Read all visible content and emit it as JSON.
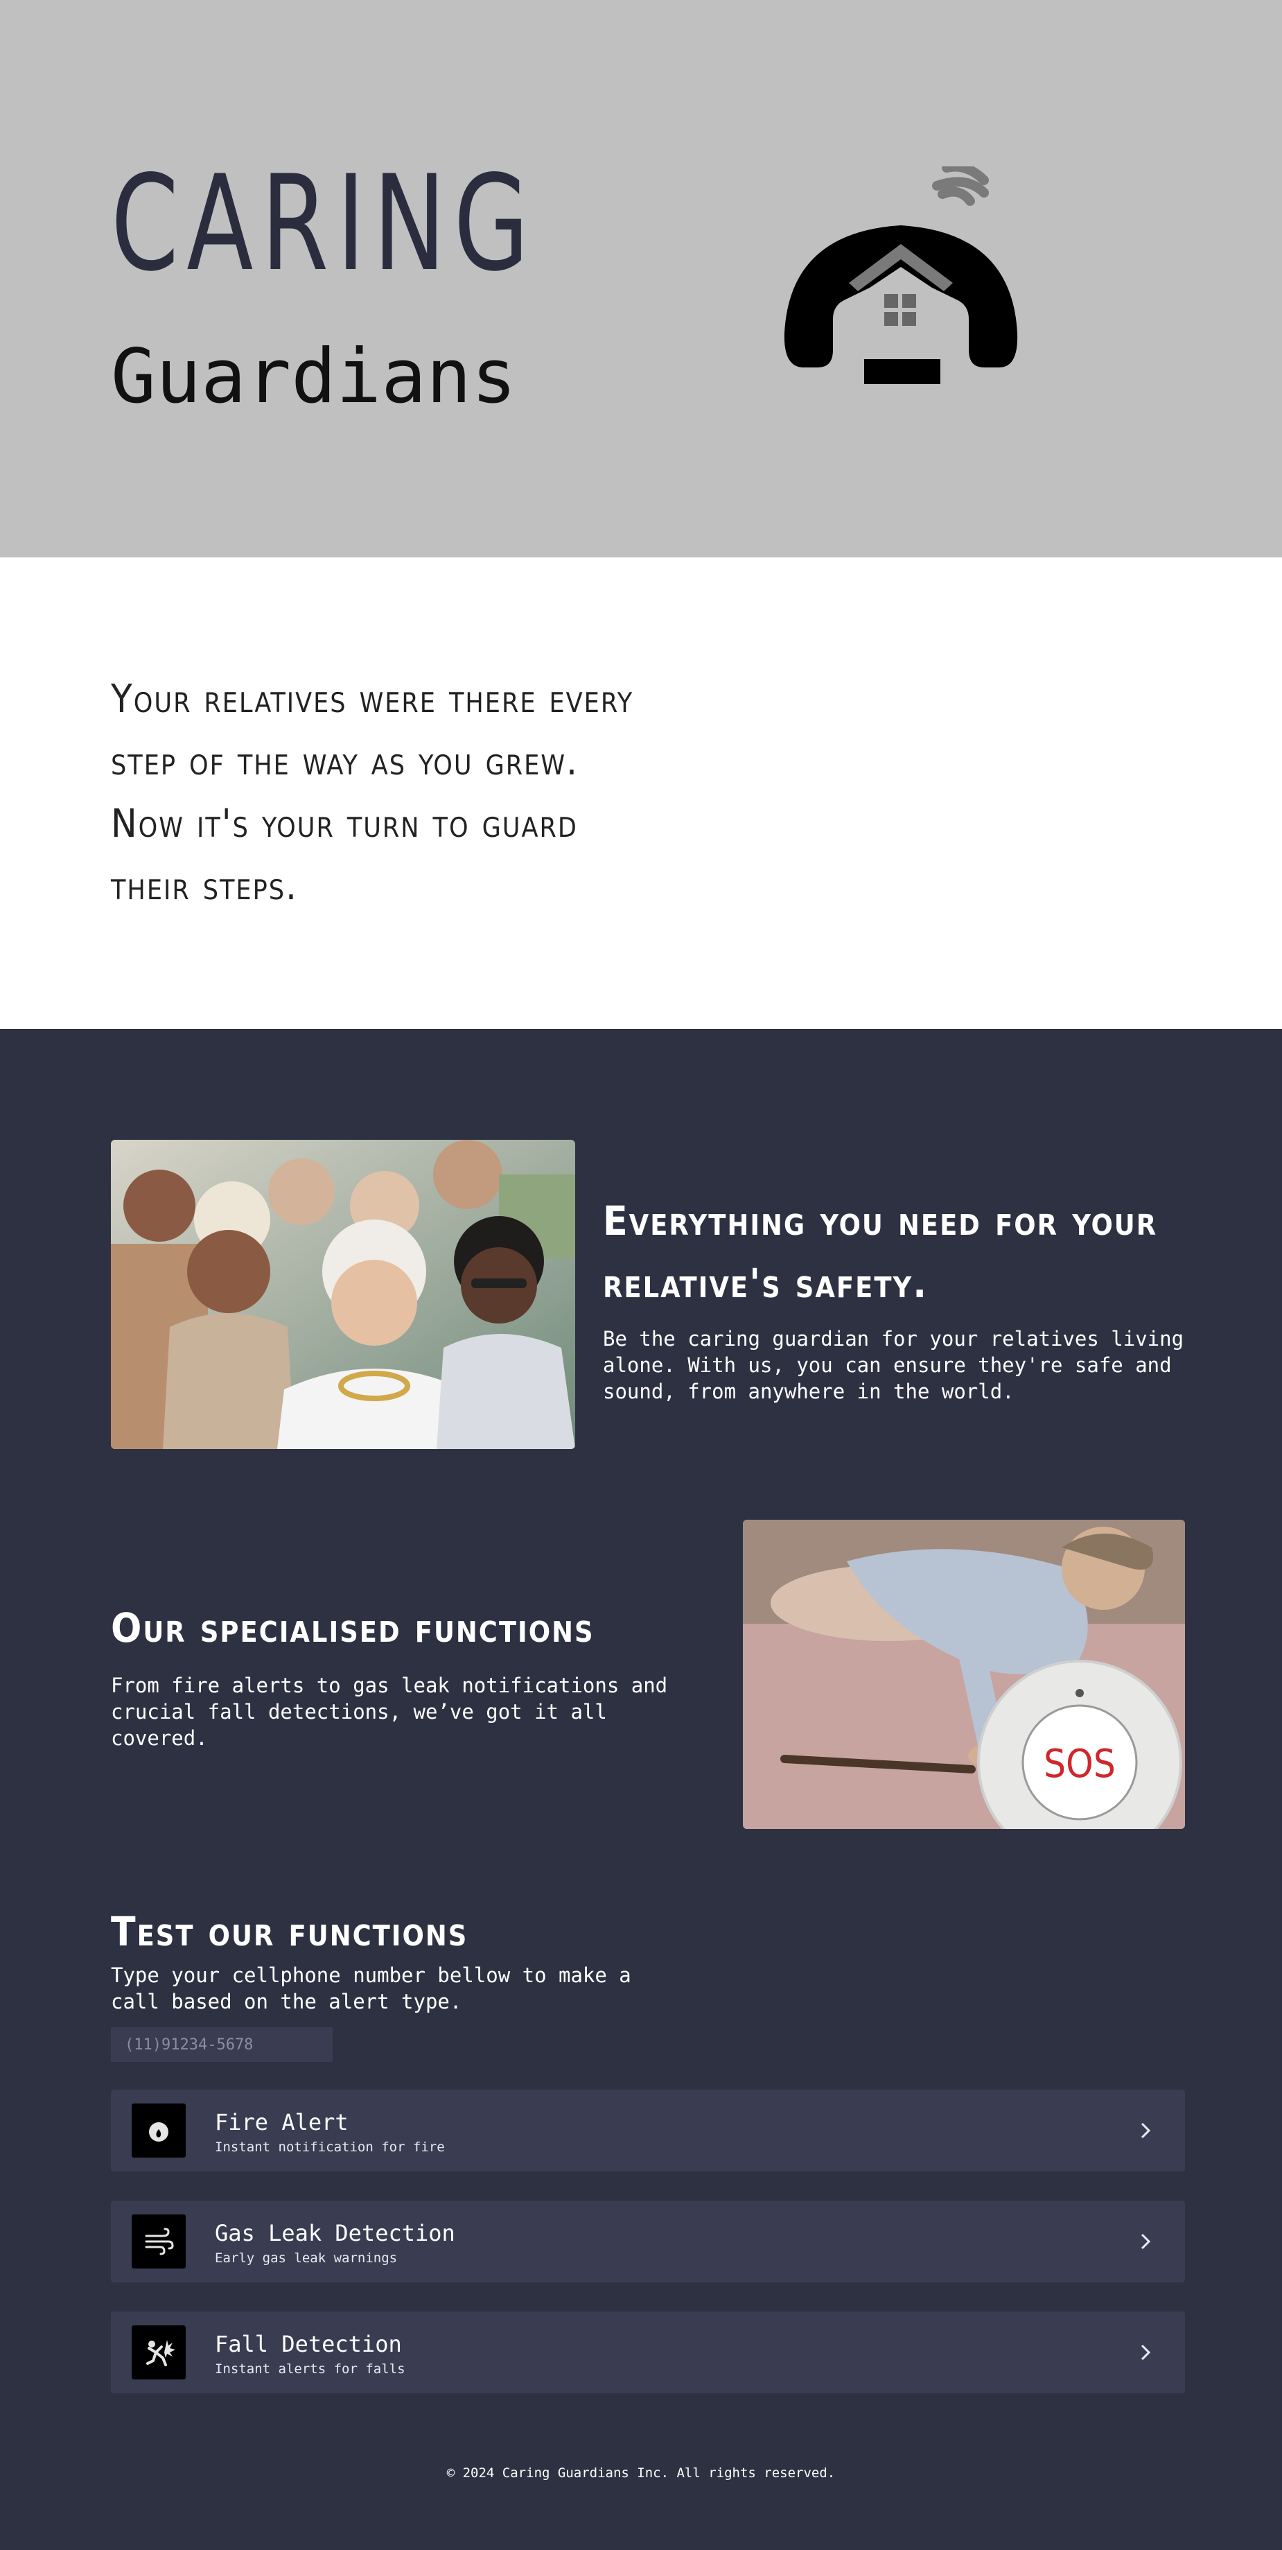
{
  "hero": {
    "title": "CARING",
    "subtitle": "Guardians",
    "logo_icon": "house-phone-signal-icon"
  },
  "intro": {
    "text": "Your relatives were there every step of the way as you grew. Now it's your turn to guard their steps."
  },
  "section_safety": {
    "title": "Everything you need for your relative's safety.",
    "body": "Be the caring guardian for your relatives living alone. With us, you can ensure they're safe and sound, from anywhere in the world.",
    "image": "group-of-smiling-seniors"
  },
  "section_functions": {
    "title": "Our specialised functions",
    "body": "From fire alerts to gas leak notifications and crucial fall detections, we’ve got it all covered.",
    "image": "fallen-senior-with-sos-button",
    "sos_label": "SOS"
  },
  "section_test": {
    "title": "Test our functions",
    "body": "Type your cellphone number bellow to make a call based on the alert type.",
    "phone_placeholder": "(11)91234-5678",
    "alerts": [
      {
        "title": "Fire Alert",
        "desc": "Instant notification for fire",
        "icon": "fire-icon"
      },
      {
        "title": "Gas Leak Detection",
        "desc": "Early gas leak warnings",
        "icon": "wind-icon"
      },
      {
        "title": "Fall Detection",
        "desc": "Instant alerts for falls",
        "icon": "person-falling-icon"
      }
    ]
  },
  "footer": {
    "text": "© 2024 Caring Guardians Inc. All rights reserved."
  },
  "colors": {
    "hero_bg": "#bfc0bf",
    "dark_bg": "#2e3142",
    "card_bg": "#3a3d52",
    "title_dark": "#2b2d3f",
    "sos_red": "#d0262c"
  }
}
